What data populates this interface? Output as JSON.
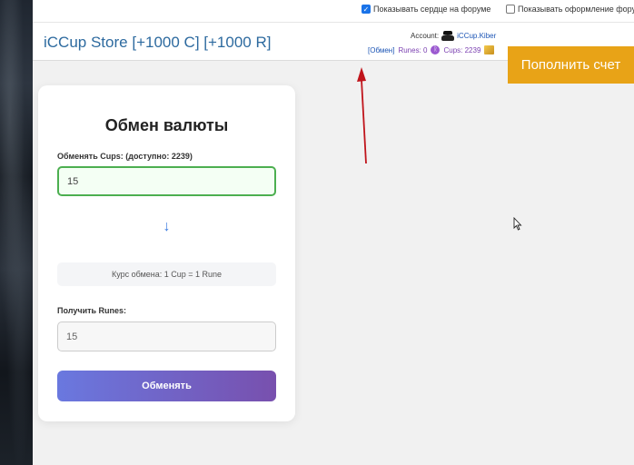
{
  "options": {
    "show_heart": {
      "label": "Показывать сердце на форуме",
      "checked": true
    },
    "show_design": {
      "label": "Показывать оформление фору",
      "checked": false
    }
  },
  "header": {
    "title_store": "iCCup Store",
    "title_c": "[+1000 C]",
    "title_r": "[+1000 R]",
    "account_label": "Account:",
    "account_name": "iCCup.Kiber",
    "exchange_link": "[Обмен]",
    "runes_label": "Runes: 0",
    "cups_label": "Cups: 2239",
    "topup_label": "Пополнить счет",
    "colors": {
      "accent": "#e8a317",
      "link": "#1c55b5",
      "runes": "#7a3fb0"
    }
  },
  "card": {
    "title": "Обмен валюты",
    "from_label": "Обменять Cups: (доступно: 2239)",
    "from_value": "15",
    "arrow": "↓",
    "rate": "Курс обмена: 1 Cup = 1 Rune",
    "to_label": "Получить Runes:",
    "to_value": "15",
    "button_label": "Обменять"
  }
}
